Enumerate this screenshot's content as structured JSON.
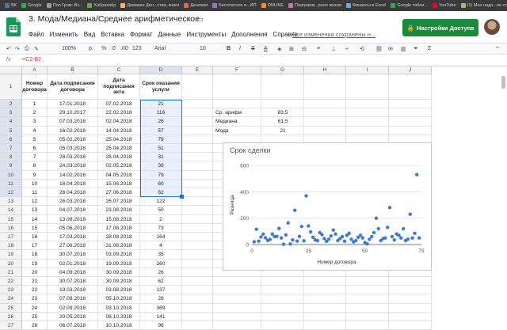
{
  "bookmarks": [
    "ВК",
    "Google",
    "Пол Грэм: Вз...",
    "Хабрахабр",
    "Демакин Ден...ства, книги",
    "Денежки",
    "Бесплатное о...ИП",
    "ONLINE",
    "Поиграем...рное жизни",
    "Финансы в Excel",
    "Google табли...",
    "YouTube",
    "(1) Мне надо...ле.cc.ru"
  ],
  "title": {
    "doc_title": "3. Мода/Медиана/Среднее арифметическое",
    "saved_status": "Все изменения сохранены н..."
  },
  "menu": [
    "Файл",
    "Изменить",
    "Вид",
    "Вставка",
    "Формат",
    "Данные",
    "Инструменты",
    "Дополнения",
    "Справка"
  ],
  "share": {
    "label": "Настройки Доступа"
  },
  "toolbar": {
    "zoom": "100%",
    "currency": "р.",
    "percent": "%",
    "dec0": ".0",
    "dec00": ".00",
    "fmt123": "123",
    "font": "Arial",
    "size": "10",
    "bold": "B",
    "italic": "I",
    "strike": "S",
    "textcolor": "A"
  },
  "formula_bar": {
    "fx": "fx",
    "value": "=C2-B2"
  },
  "columns": [
    "A",
    "B",
    "C",
    "D",
    "E",
    "F",
    "G",
    "H",
    "I",
    "J"
  ],
  "header_row": {
    "num": "1",
    "a": "Номер договора",
    "b": "Дата подписания договора",
    "c": "Дата подписания акта",
    "d": "Срок оказания услуги"
  },
  "rows": [
    {
      "n": "2",
      "a": "1",
      "b": "17.01.2018",
      "c": "07.02.2018",
      "d": "21"
    },
    {
      "n": "3",
      "a": "2",
      "b": "29.10.2017",
      "c": "22.02.2018",
      "d": "116"
    },
    {
      "n": "4",
      "a": "3",
      "b": "07.03.2018",
      "c": "02.04.2018",
      "d": "26"
    },
    {
      "n": "5",
      "a": "4",
      "b": "16.02.2018",
      "c": "14.04.2018",
      "d": "57"
    },
    {
      "n": "6",
      "a": "5",
      "b": "05.02.2018",
      "c": "25.04.2018",
      "d": "79"
    },
    {
      "n": "7",
      "a": "6",
      "b": "05.03.2018",
      "c": "25.04.2018",
      "d": "51"
    },
    {
      "n": "8",
      "a": "7",
      "b": "28.03.2018",
      "c": "28.04.2018",
      "d": "31"
    },
    {
      "n": "9",
      "a": "8",
      "b": "24.03.2018",
      "c": "02.05.2018",
      "d": "39"
    },
    {
      "n": "10",
      "a": "9",
      "b": "14.02.2018",
      "c": "04.05.2018",
      "d": "79"
    },
    {
      "n": "11",
      "a": "10",
      "b": "16.04.2018",
      "c": "15.06.2018",
      "d": "60"
    },
    {
      "n": "12",
      "a": "11",
      "b": "26.04.2018",
      "c": "27.06.2018",
      "d": "62"
    },
    {
      "n": "13",
      "a": "12",
      "b": "26.03.2018",
      "c": "26.07.2018",
      "d": "122"
    },
    {
      "n": "14",
      "a": "13",
      "b": "04.07.2018",
      "c": "23.08.2018",
      "d": "50"
    },
    {
      "n": "15",
      "a": "14",
      "b": "13.08.2018",
      "c": "15.08.2018",
      "d": "2"
    },
    {
      "n": "16",
      "a": "15",
      "b": "05.06.2018",
      "c": "17.08.2018",
      "d": "73"
    },
    {
      "n": "17",
      "a": "16",
      "b": "17.03.2018",
      "c": "28.08.2018",
      "d": "164"
    },
    {
      "n": "18",
      "a": "17",
      "b": "27.08.2018",
      "c": "31.08.2018",
      "d": "4"
    },
    {
      "n": "19",
      "a": "18",
      "b": "30.07.2018",
      "c": "03.09.2018",
      "d": "35"
    },
    {
      "n": "20",
      "a": "19",
      "b": "02.01.2018",
      "c": "19.09.2018",
      "d": "260"
    },
    {
      "n": "21",
      "a": "20",
      "b": "04.09.2018",
      "c": "30.09.2018",
      "d": "26"
    },
    {
      "n": "22",
      "a": "21",
      "b": "30.07.2018",
      "c": "30.09.2018",
      "d": "62"
    },
    {
      "n": "23",
      "a": "22",
      "b": "19.03.2018",
      "c": "03.08.2018",
      "d": "137"
    },
    {
      "n": "24",
      "a": "23",
      "b": "07.09.2018",
      "c": "05.10.2018",
      "d": "28"
    },
    {
      "n": "25",
      "a": "24",
      "b": "02.09.2018",
      "c": "03.10.2018",
      "d": "369"
    },
    {
      "n": "26",
      "a": "25",
      "b": "20.05.2018",
      "c": "08.10.2018",
      "d": "141"
    },
    {
      "n": "27",
      "a": "26",
      "b": "06.07.2018",
      "c": "10.10.2018",
      "d": "96"
    }
  ],
  "stats": [
    {
      "label": "Ср. арифм",
      "value": "83,5"
    },
    {
      "label": "Медиана",
      "value": "61,5"
    },
    {
      "label": "Мода",
      "value": "21"
    }
  ],
  "accent_colors": {
    "selection": "#1a73e8",
    "share_button": "#1a8a3b",
    "points": "#3c78d8"
  },
  "chart_data": {
    "type": "scatter",
    "title": "Срок сделки",
    "xlabel": "Номер договора",
    "ylabel": "Разница",
    "xlim": [
      0,
      75
    ],
    "ylim": [
      0,
      600
    ],
    "xticks": [
      "0",
      "25",
      "50",
      "75"
    ],
    "yticks": [
      "0",
      "200",
      "400",
      "600"
    ],
    "grid": true,
    "series": [
      {
        "x": [
          1,
          2,
          3,
          4,
          5,
          6,
          7,
          8,
          9,
          10,
          11,
          12,
          13,
          14,
          15,
          16,
          17,
          18,
          19,
          20,
          21,
          22,
          23,
          24,
          25,
          26,
          27,
          28,
          29,
          30,
          31,
          32,
          33,
          34,
          35,
          36,
          37,
          38,
          39,
          40,
          41,
          42,
          43,
          44,
          45,
          46,
          47,
          48,
          49,
          50,
          51,
          52,
          53,
          54,
          55,
          56,
          57,
          58,
          59,
          60,
          61,
          62,
          63,
          64,
          65,
          66,
          67,
          68,
          69,
          70,
          71,
          72,
          73,
          74
        ],
        "y": [
          21,
          116,
          26,
          57,
          79,
          51,
          31,
          39,
          79,
          60,
          62,
          122,
          50,
          2,
          73,
          164,
          4,
          35,
          260,
          26,
          62,
          137,
          28,
          369,
          141,
          96,
          55,
          35,
          30,
          90,
          75,
          45,
          25,
          40,
          65,
          110,
          80,
          30,
          45,
          60,
          25,
          70,
          85,
          40,
          20,
          30,
          55,
          70,
          50,
          15,
          5,
          40,
          60,
          90,
          200,
          120,
          30,
          45,
          50,
          130,
          280,
          60,
          35,
          80,
          70,
          50,
          120,
          30,
          40,
          230,
          50,
          85,
          530,
          50
        ]
      }
    ]
  }
}
